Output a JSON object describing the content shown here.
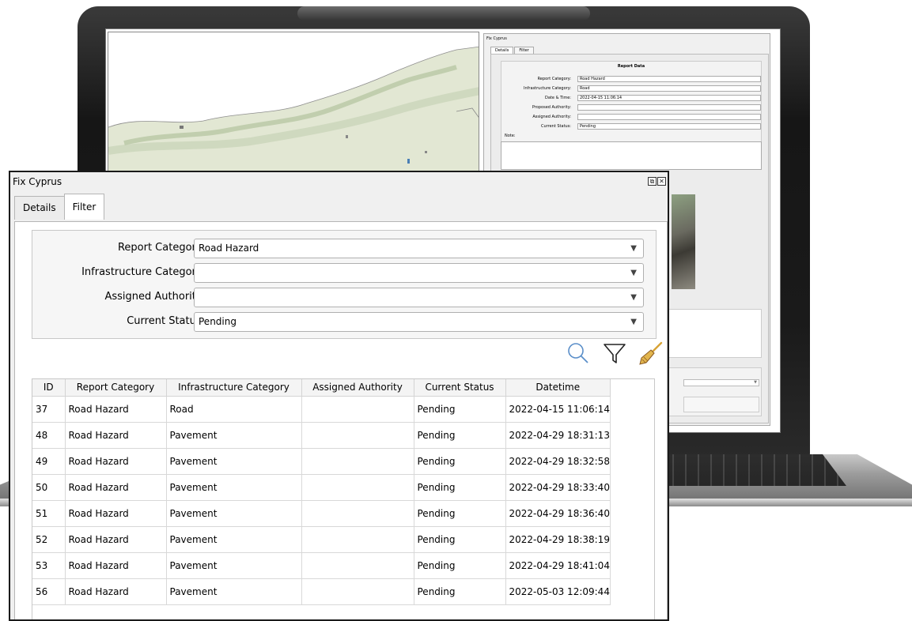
{
  "background_panel": {
    "title": "Fix Cyprus",
    "tabs": [
      "Details",
      "Filter"
    ],
    "heading": "Report Data",
    "fields": [
      {
        "label": "Report Category:",
        "value": "Road Hazard"
      },
      {
        "label": "Infrastructure Category:",
        "value": "Road"
      },
      {
        "label": "Date & Time:",
        "value": "2022-04-15 11:06:14"
      },
      {
        "label": "Proposed Authority:",
        "value": ""
      },
      {
        "label": "Assigned Authority:",
        "value": ""
      },
      {
        "label": "Current Status:",
        "value": "Pending"
      }
    ],
    "note_label": "Note:"
  },
  "window": {
    "title": "Fix Cyprus",
    "restore_glyph": "⧉",
    "close_glyph": "✕"
  },
  "tabs": [
    {
      "label": "Details",
      "active": false
    },
    {
      "label": "Filter",
      "active": true
    }
  ],
  "filter": {
    "fields": [
      {
        "label": "Report Category:",
        "value": "Road Hazard"
      },
      {
        "label": "Infrastructure Category:",
        "value": ""
      },
      {
        "label": "Assigned Authority:",
        "value": ""
      },
      {
        "label": "Current Status:",
        "value": "Pending"
      }
    ],
    "combo_arrow": "▼"
  },
  "toolbar": {
    "icons": [
      "search-icon",
      "filter-icon",
      "broom-icon"
    ]
  },
  "table": {
    "columns": [
      "ID",
      "Report Category",
      "Infrastructure Category",
      "Assigned Authority",
      "Current Status",
      "Datetime"
    ],
    "rows": [
      [
        "37",
        "Road Hazard",
        "Road",
        "",
        "Pending",
        "2022-04-15 11:06:14"
      ],
      [
        "48",
        "Road Hazard",
        "Pavement",
        "",
        "Pending",
        "2022-04-29 18:31:13"
      ],
      [
        "49",
        "Road Hazard",
        "Pavement",
        "",
        "Pending",
        "2022-04-29 18:32:58"
      ],
      [
        "50",
        "Road Hazard",
        "Pavement",
        "",
        "Pending",
        "2022-04-29 18:33:40"
      ],
      [
        "51",
        "Road Hazard",
        "Pavement",
        "",
        "Pending",
        "2022-04-29 18:36:40"
      ],
      [
        "52",
        "Road Hazard",
        "Pavement",
        "",
        "Pending",
        "2022-04-29 18:38:19"
      ],
      [
        "53",
        "Road Hazard",
        "Pavement",
        "",
        "Pending",
        "2022-04-29 18:41:04"
      ],
      [
        "56",
        "Road Hazard",
        "Pavement",
        "",
        "Pending",
        "2022-05-03 12:09:44"
      ]
    ]
  },
  "colors": {
    "window_border": "#1a1a1a",
    "panel_bg": "#f0f0f0",
    "map_land": "#dfe6cf",
    "search_icon": "#5b8fc9",
    "broom_handle": "#d8a335",
    "broom_bristles": "#8a5a22"
  }
}
